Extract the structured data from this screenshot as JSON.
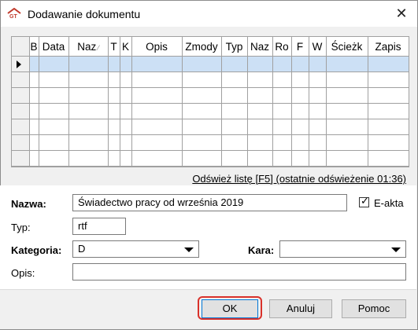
{
  "window": {
    "title": "Dodawanie dokumentu",
    "close_glyph": "✕",
    "app_icon": "app-logo-icon"
  },
  "grid": {
    "columns": [
      "B",
      "Data",
      "Naz",
      "T",
      "K",
      "Opis",
      "Zmody",
      "Typ",
      "Naz",
      "Ro",
      "F",
      "W",
      "Ścieżk",
      "Zapis"
    ],
    "sort_indicator": "⁄",
    "row_count": 8,
    "selected_row": 0
  },
  "refresh_link": "Odśwież listę [F5] (ostatnie odświeżenie 01:36)",
  "form": {
    "nazwa_label": "Nazwa:",
    "nazwa_value": "Świadectwo pracy od września 2019",
    "eakta_label": "E-akta",
    "eakta_checked": true,
    "typ_label": "Typ:",
    "typ_value": "rtf",
    "kategoria_label": "Kategoria:",
    "kategoria_value": "D",
    "kara_label": "Kara:",
    "kara_value": "",
    "opis_label": "Opis:",
    "opis_value": ""
  },
  "buttons": {
    "ok": "OK",
    "cancel": "Anuluj",
    "help": "Pomoc"
  },
  "colors": {
    "selected_row": "#cce0f5",
    "highlight": "#d9312a"
  }
}
